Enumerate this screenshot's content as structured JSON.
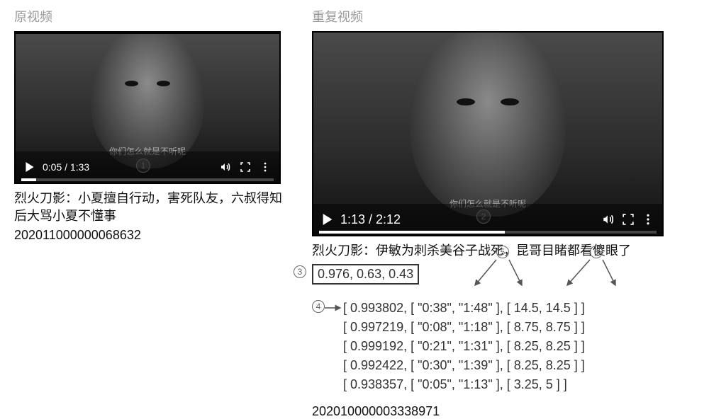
{
  "left": {
    "section_label": "原视频",
    "subtitle": "你们怎么就是不听呢",
    "timecode": "0:05 / 1:33",
    "progress_pct": 6,
    "caption": "烈火刀影：小夏擅自行动，害死队友，六叔得知后大骂小夏不懂事",
    "id": "202011000000068632",
    "marker1": "1"
  },
  "right": {
    "section_label": "重复视频",
    "subtitle": "你们怎么就是不听呢",
    "timecode": "1:13 / 2:12",
    "progress_pct": 55,
    "caption": "烈火刀影：伊敏为刺杀美谷子战死，昆哥目睹都看傻眼了",
    "scores": "0.976, 0.63, 0.43",
    "id": "202010000003338971",
    "marker2": "2",
    "marker3": "3",
    "marker4": "4",
    "marker5": "5",
    "marker6": "6",
    "metrics": [
      "[ 0.993802, [ \"0:38\", \"1:48\" ], [ 14.5, 14.5 ] ]",
      "[ 0.997219, [ \"0:08\", \"1:18\" ], [ 8.75, 8.75 ] ]",
      "[ 0.999192, [ \"0:21\", \"1:31\" ], [ 8.25, 8.25 ] ]",
      "[ 0.992422, [ \"0:30\", \"1:39\" ], [ 8.25, 8.25 ] ]",
      "[ 0.938357, [ \"0:05\", \"1:13\" ], [ 3.25, 5 ] ]"
    ]
  },
  "icons": {
    "play": "play-icon",
    "volume": "volume-icon",
    "fullscreen": "fullscreen-icon",
    "more": "more-icon"
  }
}
